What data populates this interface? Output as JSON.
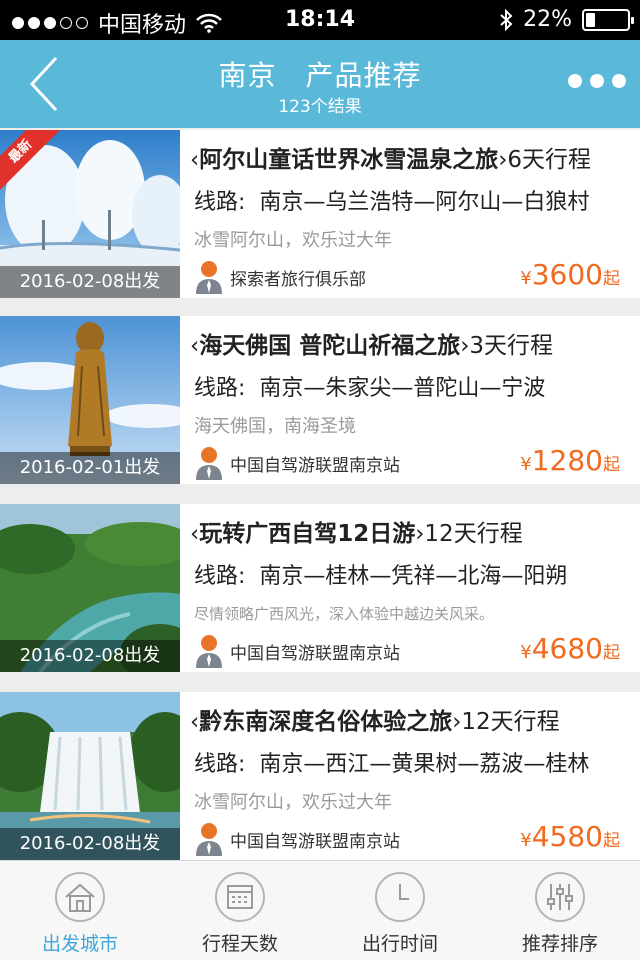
{
  "status_bar": {
    "carrier": "中国移动",
    "time": "18:14",
    "battery": "22%",
    "battery_level": 0.22
  },
  "nav": {
    "title": "南京　产品推荐",
    "subtitle": "123个结果"
  },
  "products": [
    {
      "badge": "最新",
      "title": "阿尔山童话世界冰雪温泉之旅",
      "days": "6天行程",
      "route_label": "线路:",
      "route": "南京—乌兰浩特—阿尔山—白狼村",
      "desc": "冰雪阿尔山，欢乐过大年",
      "agency": "探索者旅行俱乐部",
      "currency": "¥",
      "price": "3600",
      "price_suffix": "起",
      "date": "2016-02-08出发"
    },
    {
      "title": "海天佛国 普陀山祈福之旅",
      "days": "3天行程",
      "route_label": "线路:",
      "route": "南京—朱家尖—普陀山—宁波",
      "desc": "海天佛国，南海圣境",
      "agency": "中国自驾游联盟南京站",
      "currency": "¥",
      "price": "1280",
      "price_suffix": "起",
      "date": "2016-02-01出发"
    },
    {
      "title": "玩转广西自驾12日游",
      "days": "12天行程",
      "route_label": "线路:",
      "route": "南京—桂林—凭祥—北海—阳朔",
      "desc": "尽情领略广西风光，深入体验中越边关风采。",
      "agency": "中国自驾游联盟南京站",
      "currency": "¥",
      "price": "4680",
      "price_suffix": "起",
      "date": "2016-02-08出发"
    },
    {
      "title": "黔东南深度名俗体验之旅",
      "days": "12天行程",
      "route_label": "线路:",
      "route": "南京—西江—黄果树—荔波—桂林",
      "desc": "冰雪阿尔山，欢乐过大年",
      "agency": "中国自驾游联盟南京站",
      "currency": "¥",
      "price": "4580",
      "price_suffix": "起",
      "date": "2016-02-08出发"
    }
  ],
  "tabs": [
    {
      "label": "出发城市",
      "icon": "house-icon",
      "active": true
    },
    {
      "label": "行程天数",
      "icon": "calendar-icon",
      "active": false
    },
    {
      "label": "出行时间",
      "icon": "clock-icon",
      "active": false
    },
    {
      "label": "推荐排序",
      "icon": "sliders-icon",
      "active": false
    }
  ],
  "colors": {
    "accent": "#5ab8d9",
    "price": "#f06a1f",
    "active_tab": "#3fa8d6",
    "badge": "#e0322b"
  }
}
